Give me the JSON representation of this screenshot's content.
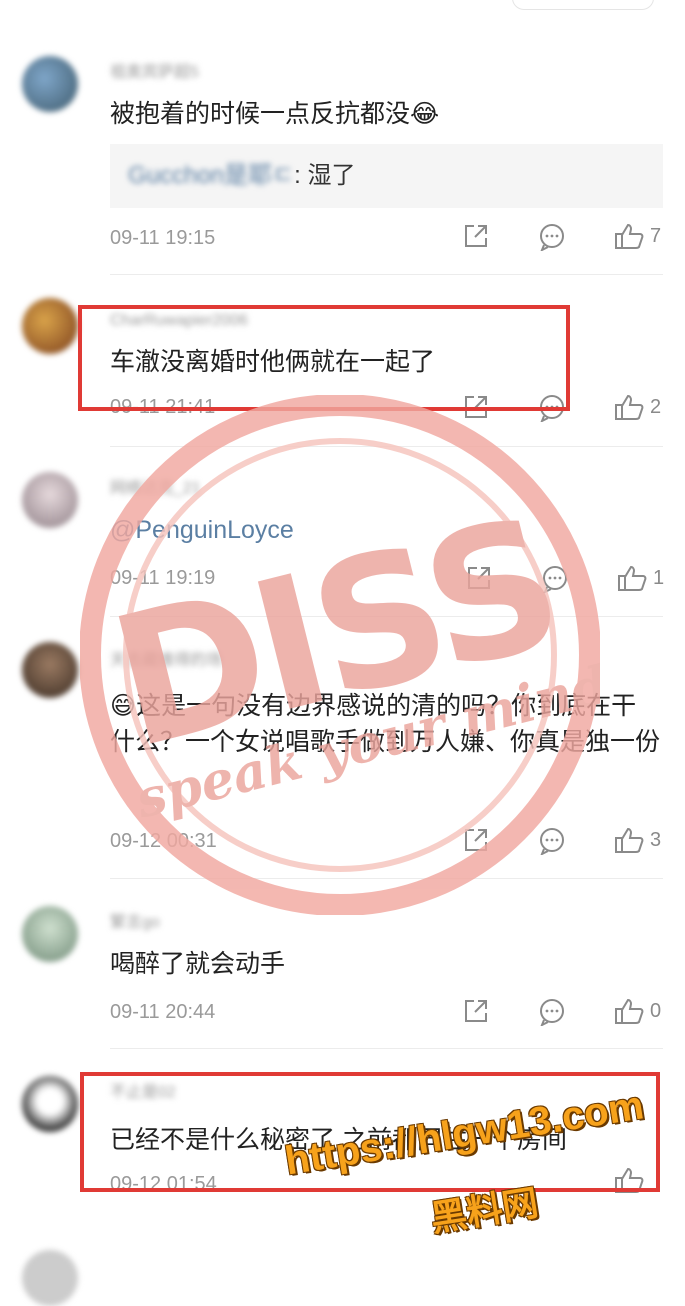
{
  "comments": [
    {
      "username": "祖奥宾萨超5",
      "text": "被抱着的时候一点反抗都没",
      "emoji": "😂",
      "reply": {
        "name": "Gucchon是耶ㄷ",
        "text": ": 湿了"
      },
      "time": "09-11 19:15",
      "likes": "7"
    },
    {
      "username": "CharRuwapier2006",
      "text": "车澈没离婚时他俩就在一起了",
      "time": "09-11 21:41",
      "likes": "2"
    },
    {
      "username": "网络达克_21",
      "text": "@PenguinLoyce",
      "time": "09-11 19:19",
      "likes": "1"
    },
    {
      "username": "天去藏维得的场",
      "emoji": "😅",
      "text": "这是一句没有边界感说的清的吗？你到底在干什么？一个女说唱歌手做到万人嫌、你真是独一份",
      "time": "09-12 00:31",
      "likes": "3"
    },
    {
      "username": "繁言go",
      "text": "喝醉了就会动手",
      "time": "09-11 20:44",
      "likes": "0"
    },
    {
      "username": "不止是02",
      "text": "已经不是什么秘密了,之前都同住一个房间",
      "time": "09-12 01:54",
      "likes": ""
    }
  ],
  "stamp": {
    "main": "DISS",
    "sub": "speak your mind"
  },
  "watermark": {
    "url": "https://hlgw13.com",
    "name": "黑料网"
  },
  "colors": {
    "highlight": "#e03a35",
    "mention": "#5b7fa3",
    "watermark": "#f7a21b"
  }
}
